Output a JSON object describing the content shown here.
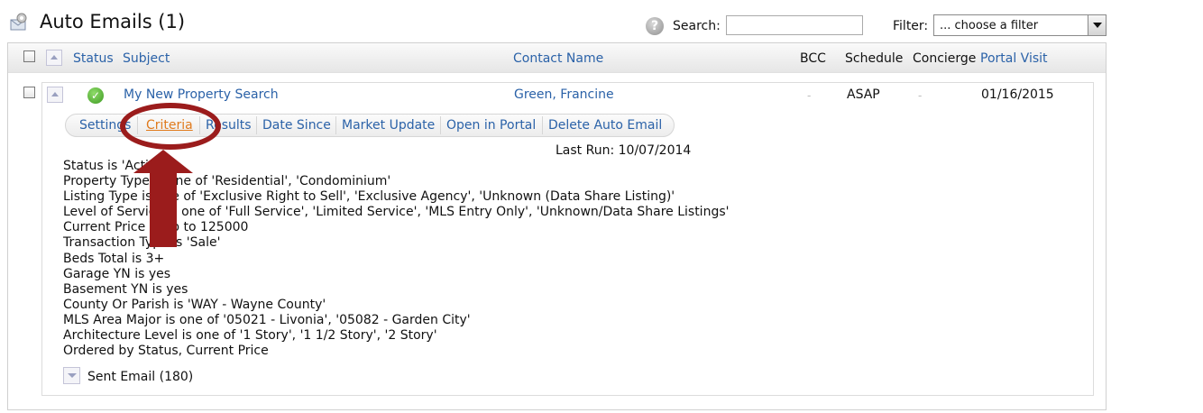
{
  "header": {
    "title": "Auto Emails (1)",
    "search_label": "Search:",
    "search_value": "",
    "filter_label": "Filter:",
    "filter_value": "... choose a filter"
  },
  "columns": {
    "status": "Status",
    "subject": "Subject",
    "contact": "Contact Name",
    "bcc": "BCC",
    "schedule": "Schedule",
    "concierge": "Concierge",
    "portal_visit": "Portal Visit"
  },
  "row": {
    "subject": "My New Property Search",
    "contact": "Green, Francine",
    "bcc": "-",
    "schedule": "ASAP",
    "concierge": "-",
    "portal_visit": "01/16/2015"
  },
  "tabs": [
    "Settings",
    "Criteria",
    "Results",
    "Date Since",
    "Market Update",
    "Open in Portal",
    "Delete Auto Email"
  ],
  "active_tab": "Criteria",
  "last_run": "Last Run: 10/07/2014",
  "criteria_lines": [
    "Status is 'Active'",
    "Property Type is one of 'Residential', 'Condominium'",
    "Listing Type is one of 'Exclusive Right to Sell', 'Exclusive Agency', 'Unknown (Data Share Listing)'",
    "Level of Service is one of 'Full Service', 'Limited Service', 'MLS Entry Only', 'Unknown/Data Share Listings'",
    "Current Price is up to 125000",
    "Transaction Type is 'Sale'",
    "Beds Total is 3+",
    "Garage YN is yes",
    "Basement YN is yes",
    "County Or Parish is 'WAY - Wayne County'",
    "MLS Area Major is one of '05021 - Livonia', '05082 - Garden City'",
    "Architecture Level is one of '1 Story', '1 1/2 Story', '2 Story'",
    "Ordered by Status, Current Price"
  ],
  "sent_email": "Sent Email (180)",
  "colors": {
    "link": "#2b62a8",
    "active_tab": "#e07a1c",
    "annotation": "#9b1c1c",
    "status_ok": "#3e9a22"
  },
  "icons": {
    "title": "auto-email-gear-icon",
    "help": "help-icon",
    "status": "status-ok-icon"
  }
}
